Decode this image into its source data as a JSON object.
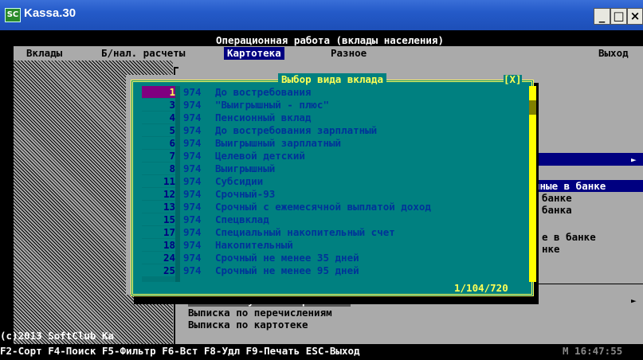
{
  "window": {
    "title": "Kassa.30",
    "icon": "app-sc-icon",
    "buttons": [
      "minimize",
      "maximize",
      "close"
    ]
  },
  "header": {
    "title": "Операционная работа (вклады населения)"
  },
  "menu": {
    "items": [
      "Вклады",
      "Б/нал. расчеты",
      "Картотека",
      "Разное",
      "Выход"
    ],
    "active": "Картотека"
  },
  "background_panel": {
    "fragments": [
      "нные в банке",
      "банке",
      "банка",
      "е в банке",
      "нке"
    ],
    "items": [
      "Изменение условий хранения",
      "Выписка по перечислениям",
      "Выписка по картотеке"
    ]
  },
  "dialog": {
    "title": "Выбор вида вклада",
    "close": "[X]",
    "footer": "1/104/720",
    "rows": [
      {
        "num": "1",
        "code": "974",
        "name": "До востребования"
      },
      {
        "num": "3",
        "code": "974",
        "name": "\"Выигрышный - плюс\""
      },
      {
        "num": "4",
        "code": "974",
        "name": "Пенсионный вклад"
      },
      {
        "num": "5",
        "code": "974",
        "name": "До востребования зарплатный"
      },
      {
        "num": "6",
        "code": "974",
        "name": "Выигрышный зарплатный"
      },
      {
        "num": "7",
        "code": "974",
        "name": "Целевой детский"
      },
      {
        "num": "8",
        "code": "974",
        "name": "Выигрышный"
      },
      {
        "num": "11",
        "code": "974",
        "name": "Субсидии"
      },
      {
        "num": "12",
        "code": "974",
        "name": "Срочный-93"
      },
      {
        "num": "13",
        "code": "974",
        "name": "Срочный с ежемесячной выплатой доход"
      },
      {
        "num": "15",
        "code": "974",
        "name": "Спецвклад"
      },
      {
        "num": "17",
        "code": "974",
        "name": "Специальный накопительный счет"
      },
      {
        "num": "18",
        "code": "974",
        "name": "Накопительный"
      },
      {
        "num": "24",
        "code": "974",
        "name": "Срочный не менее 35 дней"
      },
      {
        "num": "25",
        "code": "974",
        "name": "Срочный не менее 95 дней"
      }
    ]
  },
  "status": {
    "copyright": "(c)2013 SoftClub Ka",
    "fkeys": "F2-Сорт F4-Поиск F5-Фильтр F6-Вст F8-Удл F9-Печать ESC-Выход",
    "clock": "М 16:47:55"
  },
  "colors": {
    "titlebar": "#245ac8",
    "dialog_bg": "#008080",
    "frame": "#ffff55",
    "selection": "#800080"
  }
}
